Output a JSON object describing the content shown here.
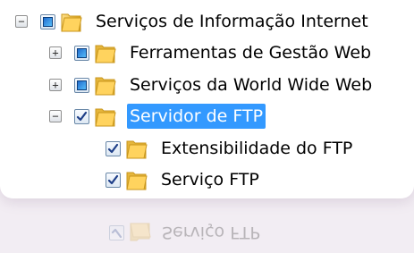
{
  "tree": {
    "root": {
      "expander": "−",
      "state": "partial",
      "label": "Serviços de Informação Internet"
    },
    "items": [
      {
        "expander": "+",
        "state": "partial",
        "label": "Ferramentas de Gestão Web"
      },
      {
        "expander": "+",
        "state": "partial",
        "label": "Serviços da World Wide Web"
      },
      {
        "expander": "−",
        "state": "checked",
        "label": "Servidor de FTP",
        "selected": true,
        "children": [
          {
            "state": "checked",
            "label": "Extensibilidade do FTP"
          },
          {
            "state": "checked",
            "label": "Serviço FTP"
          }
        ]
      }
    ]
  },
  "reflection": {
    "label": "Serviço FTP"
  },
  "colors": {
    "selection": "#3399ff",
    "partial_fill_start": "#1b63c9",
    "partial_fill_end": "#5cc7ff",
    "checkmark": "#1f3f88",
    "folder_light": "#ffe08a",
    "folder_dark": "#dca61f",
    "background": "#f2edf3"
  }
}
